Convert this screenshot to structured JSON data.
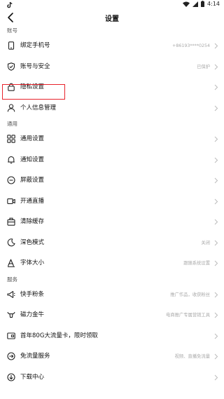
{
  "status_bar": {
    "time": "4:14",
    "app_logo_icon": "tiktok-logo-icon"
  },
  "header": {
    "title": "设置",
    "back_icon": "back-arrow-icon"
  },
  "sections": {
    "account": {
      "title": "账号",
      "items": [
        {
          "label": "绑定手机号",
          "value": "+86193****0254",
          "icon": "phone-icon"
        },
        {
          "label": "账号与安全",
          "value": "已保护",
          "icon": "shield-check-icon"
        },
        {
          "label": "隐私设置",
          "value": "",
          "icon": "lock-icon"
        },
        {
          "label": "个人信息管理",
          "value": "",
          "icon": "person-icon"
        }
      ]
    },
    "general": {
      "title": "通用",
      "items": [
        {
          "label": "通用设置",
          "value": "",
          "icon": "grid-icon"
        },
        {
          "label": "通知设置",
          "value": "",
          "icon": "bell-icon"
        },
        {
          "label": "屏蔽设置",
          "value": "",
          "icon": "block-icon"
        },
        {
          "label": "开通直播",
          "value": "",
          "icon": "live-camera-icon"
        },
        {
          "label": "清除缓存",
          "value": "",
          "icon": "clear-cache-icon"
        },
        {
          "label": "深色模式",
          "value": "关闭",
          "icon": "moon-icon"
        },
        {
          "label": "字体大小",
          "value": "跟随系统设置",
          "icon": "font-size-icon"
        }
      ]
    },
    "services": {
      "title": "服务",
      "items": [
        {
          "label": "快手粉条",
          "value": "推广作品，收获粉丝",
          "icon": "promote-icon"
        },
        {
          "label": "磁力金牛",
          "value": "电商推广专属营销工具",
          "icon": "bull-icon"
        },
        {
          "label": "首年80G大流量卡，限时领取",
          "value": "",
          "icon": "sim-card-icon"
        },
        {
          "label": "免流量服务",
          "value": "视频、直播免流量",
          "icon": "free-data-icon"
        },
        {
          "label": "下载中心",
          "value": "",
          "icon": "download-icon"
        }
      ]
    }
  },
  "colors": {
    "highlight_border": "#e8232b",
    "section_header": "#555555",
    "value_text": "#aaaaaa"
  }
}
